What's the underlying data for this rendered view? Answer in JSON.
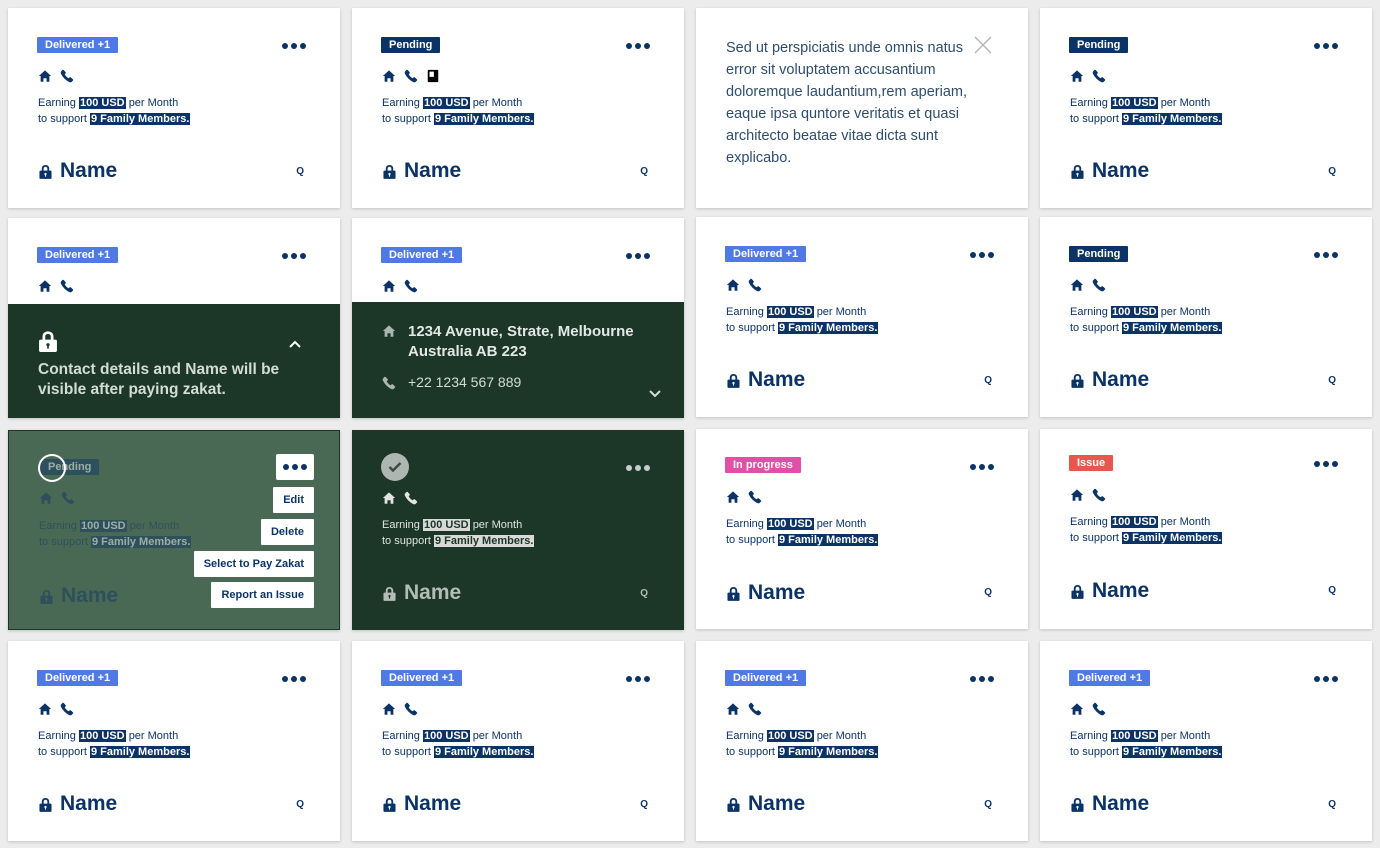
{
  "common": {
    "earning_prefix": "Earning",
    "amount": "100 USD",
    "earning_suffix": "per Month",
    "support_prefix": "to support",
    "family": "9 Family Members.",
    "name": "Name",
    "q": "Q"
  },
  "badges": {
    "delivered": "Delivered +1",
    "pending": "Pending",
    "in_progress": "In progress",
    "issue": "Issue"
  },
  "colors": {
    "navy": "#0b3366",
    "delivered": "#4f7ae6",
    "in_progress": "#e24fa7",
    "issue": "#e8574d",
    "dark_green": "#1c3728",
    "overlay_green": "#4a6955"
  },
  "icons": [
    "home-icon",
    "phone-icon",
    "id-card-icon",
    "lock-icon",
    "close-icon",
    "more-icon",
    "chevron-up-icon",
    "chevron-down-icon",
    "check-icon"
  ],
  "info_text": "Sed ut perspiciatis unde omnis natus error sit voluptatem accusantium doloremque laudantium,rem aperiam, eaque ipsa quntore veritatis et quasi architecto beatae vitae dicta sunt explicabo.",
  "locked_message": "Contact details and Name will be visible after paying zakat.",
  "contact": {
    "address": "1234 Avenue, Strate, Melbourne Australia AB 223",
    "phone": "+22 1234 567 889"
  },
  "menu": {
    "edit": "Edit",
    "delete": "Delete",
    "select_to_pay": "Select to Pay Zakat",
    "report_issue": "Report an Issue"
  }
}
